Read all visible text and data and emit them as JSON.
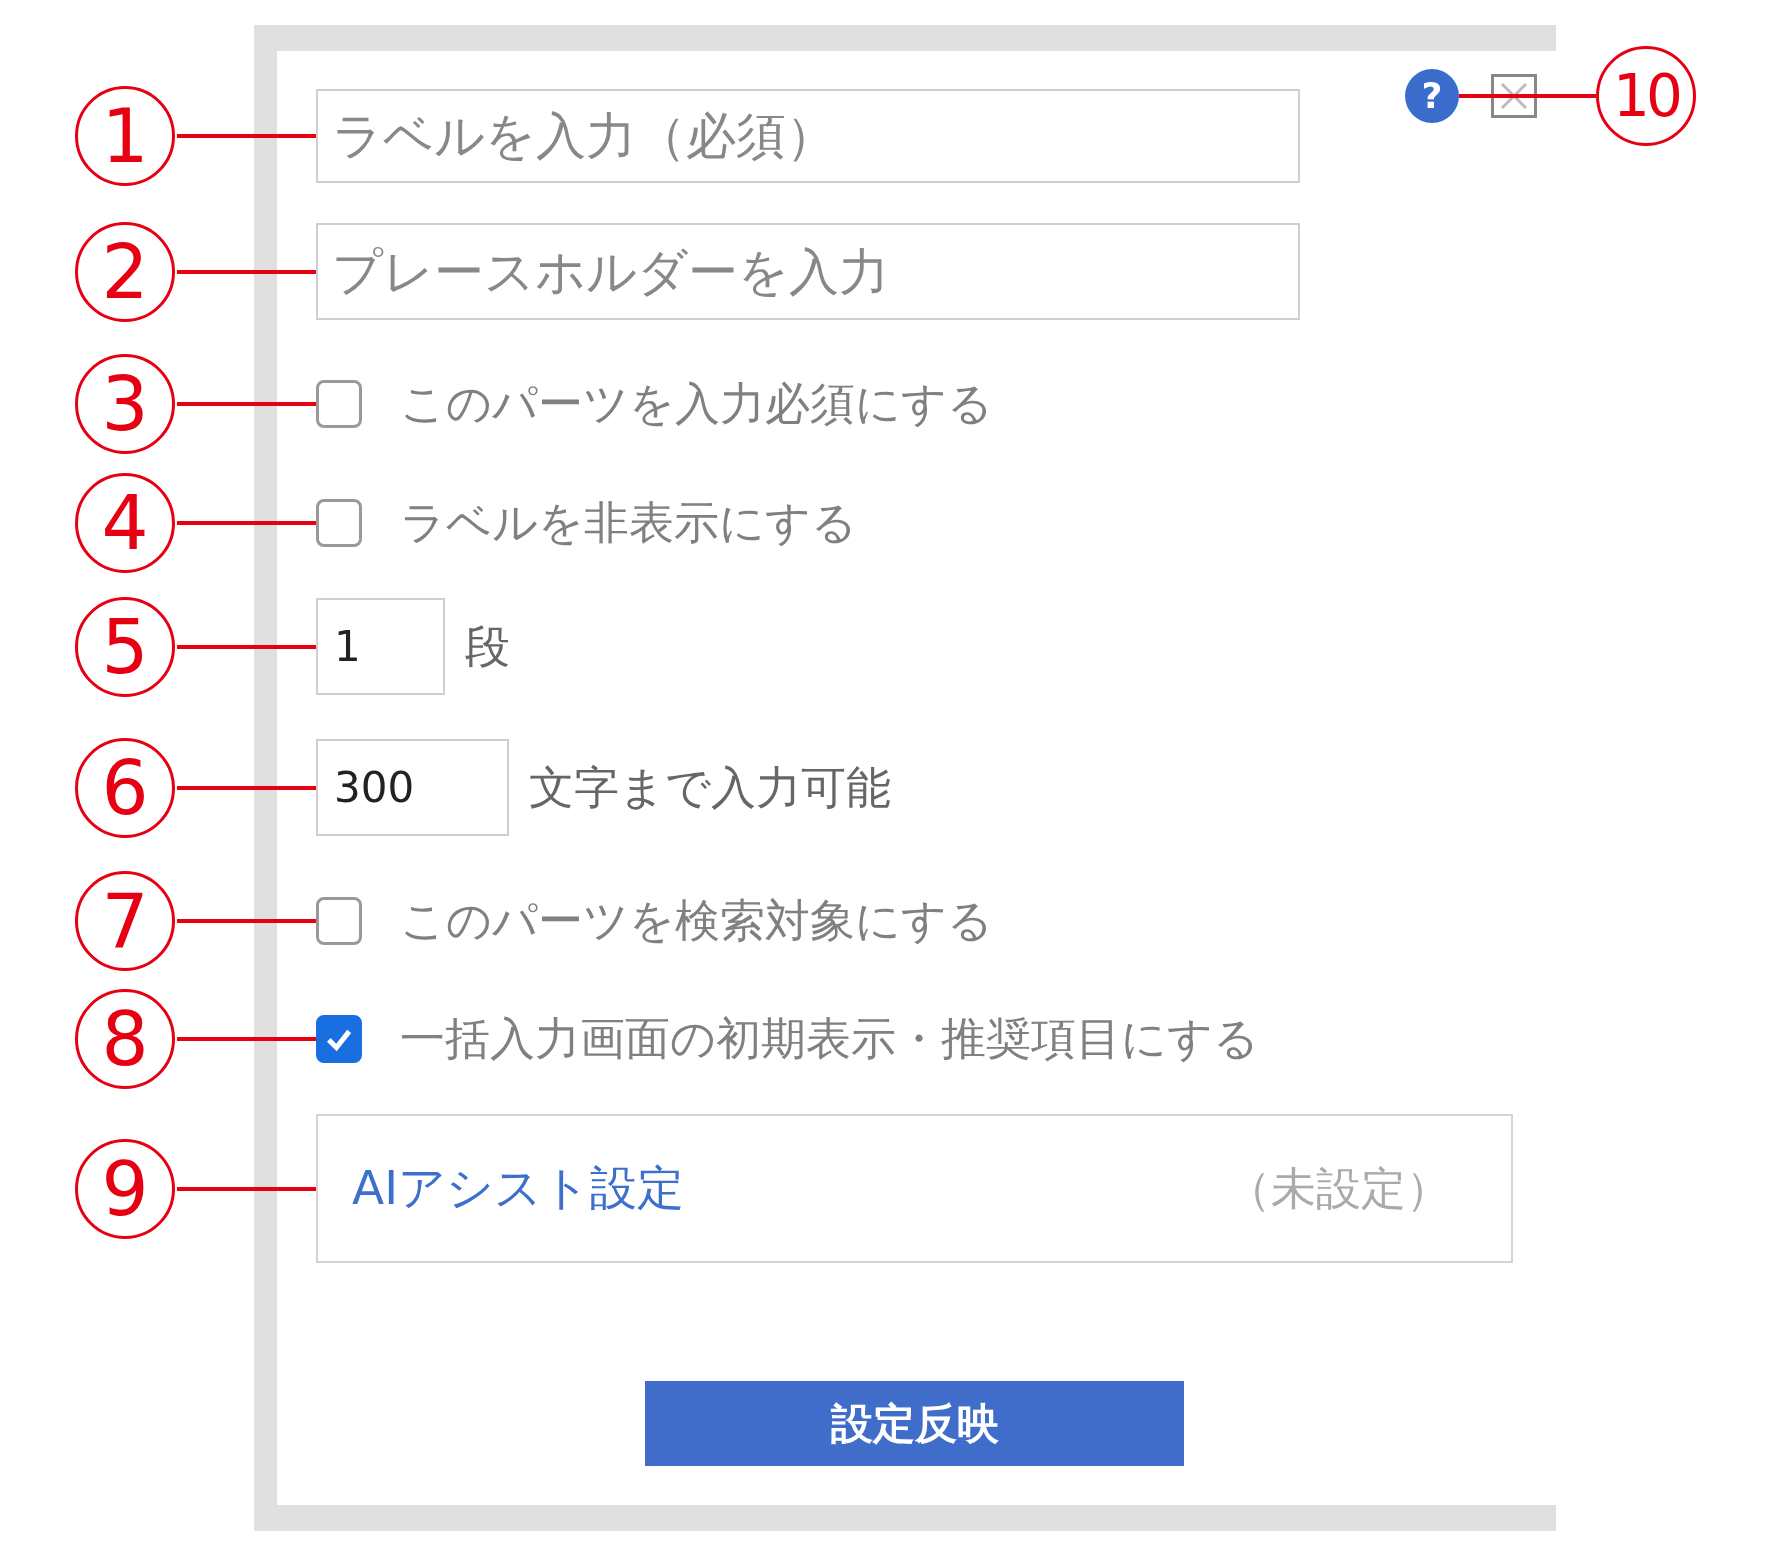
{
  "dialog": {
    "help_icon": "?",
    "items": [
      {
        "kind": "text-input",
        "placeholder": "ラベルを入力（必須）"
      },
      {
        "kind": "text-input",
        "placeholder": "プレースホルダーを入力"
      },
      {
        "kind": "checkbox",
        "label": "このパーツを入力必須にする",
        "checked": false
      },
      {
        "kind": "checkbox",
        "label": "ラベルを非表示にする",
        "checked": false
      },
      {
        "kind": "number-input",
        "value": "1",
        "suffix": "段"
      },
      {
        "kind": "number-input",
        "value": "300",
        "suffix": "文字まで入力可能"
      },
      {
        "kind": "checkbox",
        "label": "このパーツを検索対象にする",
        "checked": false
      },
      {
        "kind": "checkbox",
        "label": "一括入力画面の初期表示・推奨項目にする",
        "checked": true
      },
      {
        "kind": "link-box",
        "label": "AIアシスト設定",
        "status": "（未設定）"
      },
      {
        "kind": "button",
        "label": "設定反映"
      }
    ]
  },
  "callouts": [
    {
      "number": "1"
    },
    {
      "number": "2"
    },
    {
      "number": "3"
    },
    {
      "number": "4"
    },
    {
      "number": "5"
    },
    {
      "number": "6"
    },
    {
      "number": "7"
    },
    {
      "number": "8"
    },
    {
      "number": "9"
    },
    {
      "number": "10"
    }
  ]
}
